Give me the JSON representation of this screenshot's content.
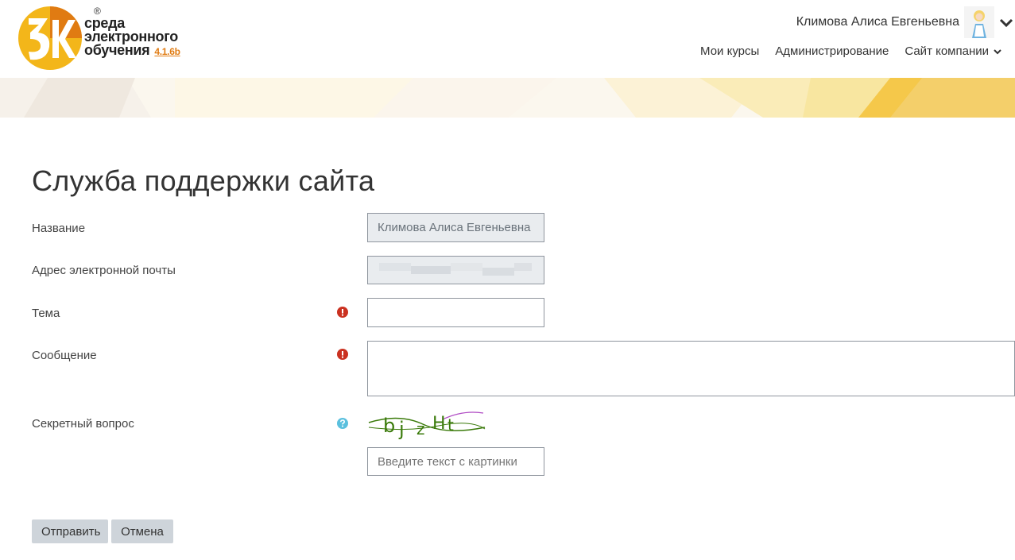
{
  "header": {
    "logo": {
      "brand_line1": "среда",
      "brand_line2": "электронного",
      "brand_line3": "обучения",
      "version": "4.1.6b",
      "reg_mark": "®"
    },
    "user": {
      "name": "Климова Алиса Евгеньевна"
    },
    "nav": [
      {
        "label": "Мои курсы"
      },
      {
        "label": "Администрирование"
      },
      {
        "label": "Сайт компании"
      }
    ]
  },
  "page": {
    "title": "Служба поддержки сайта"
  },
  "form": {
    "name": {
      "label": "Название",
      "value": "Климова Алиса Евгеньевна"
    },
    "email": {
      "label": "Адрес электронной почты"
    },
    "subject": {
      "label": "Тема",
      "value": ""
    },
    "message": {
      "label": "Сообщение",
      "value": ""
    },
    "captcha": {
      "label": "Секретный вопрос",
      "placeholder": "Введите текст с картинки"
    }
  },
  "buttons": {
    "submit": "Отправить",
    "cancel": "Отмена"
  },
  "colors": {
    "accent": "#e07b12",
    "required": "#ca3120",
    "help": "#5bc0de",
    "captcha_text": "#3a7a0a"
  }
}
